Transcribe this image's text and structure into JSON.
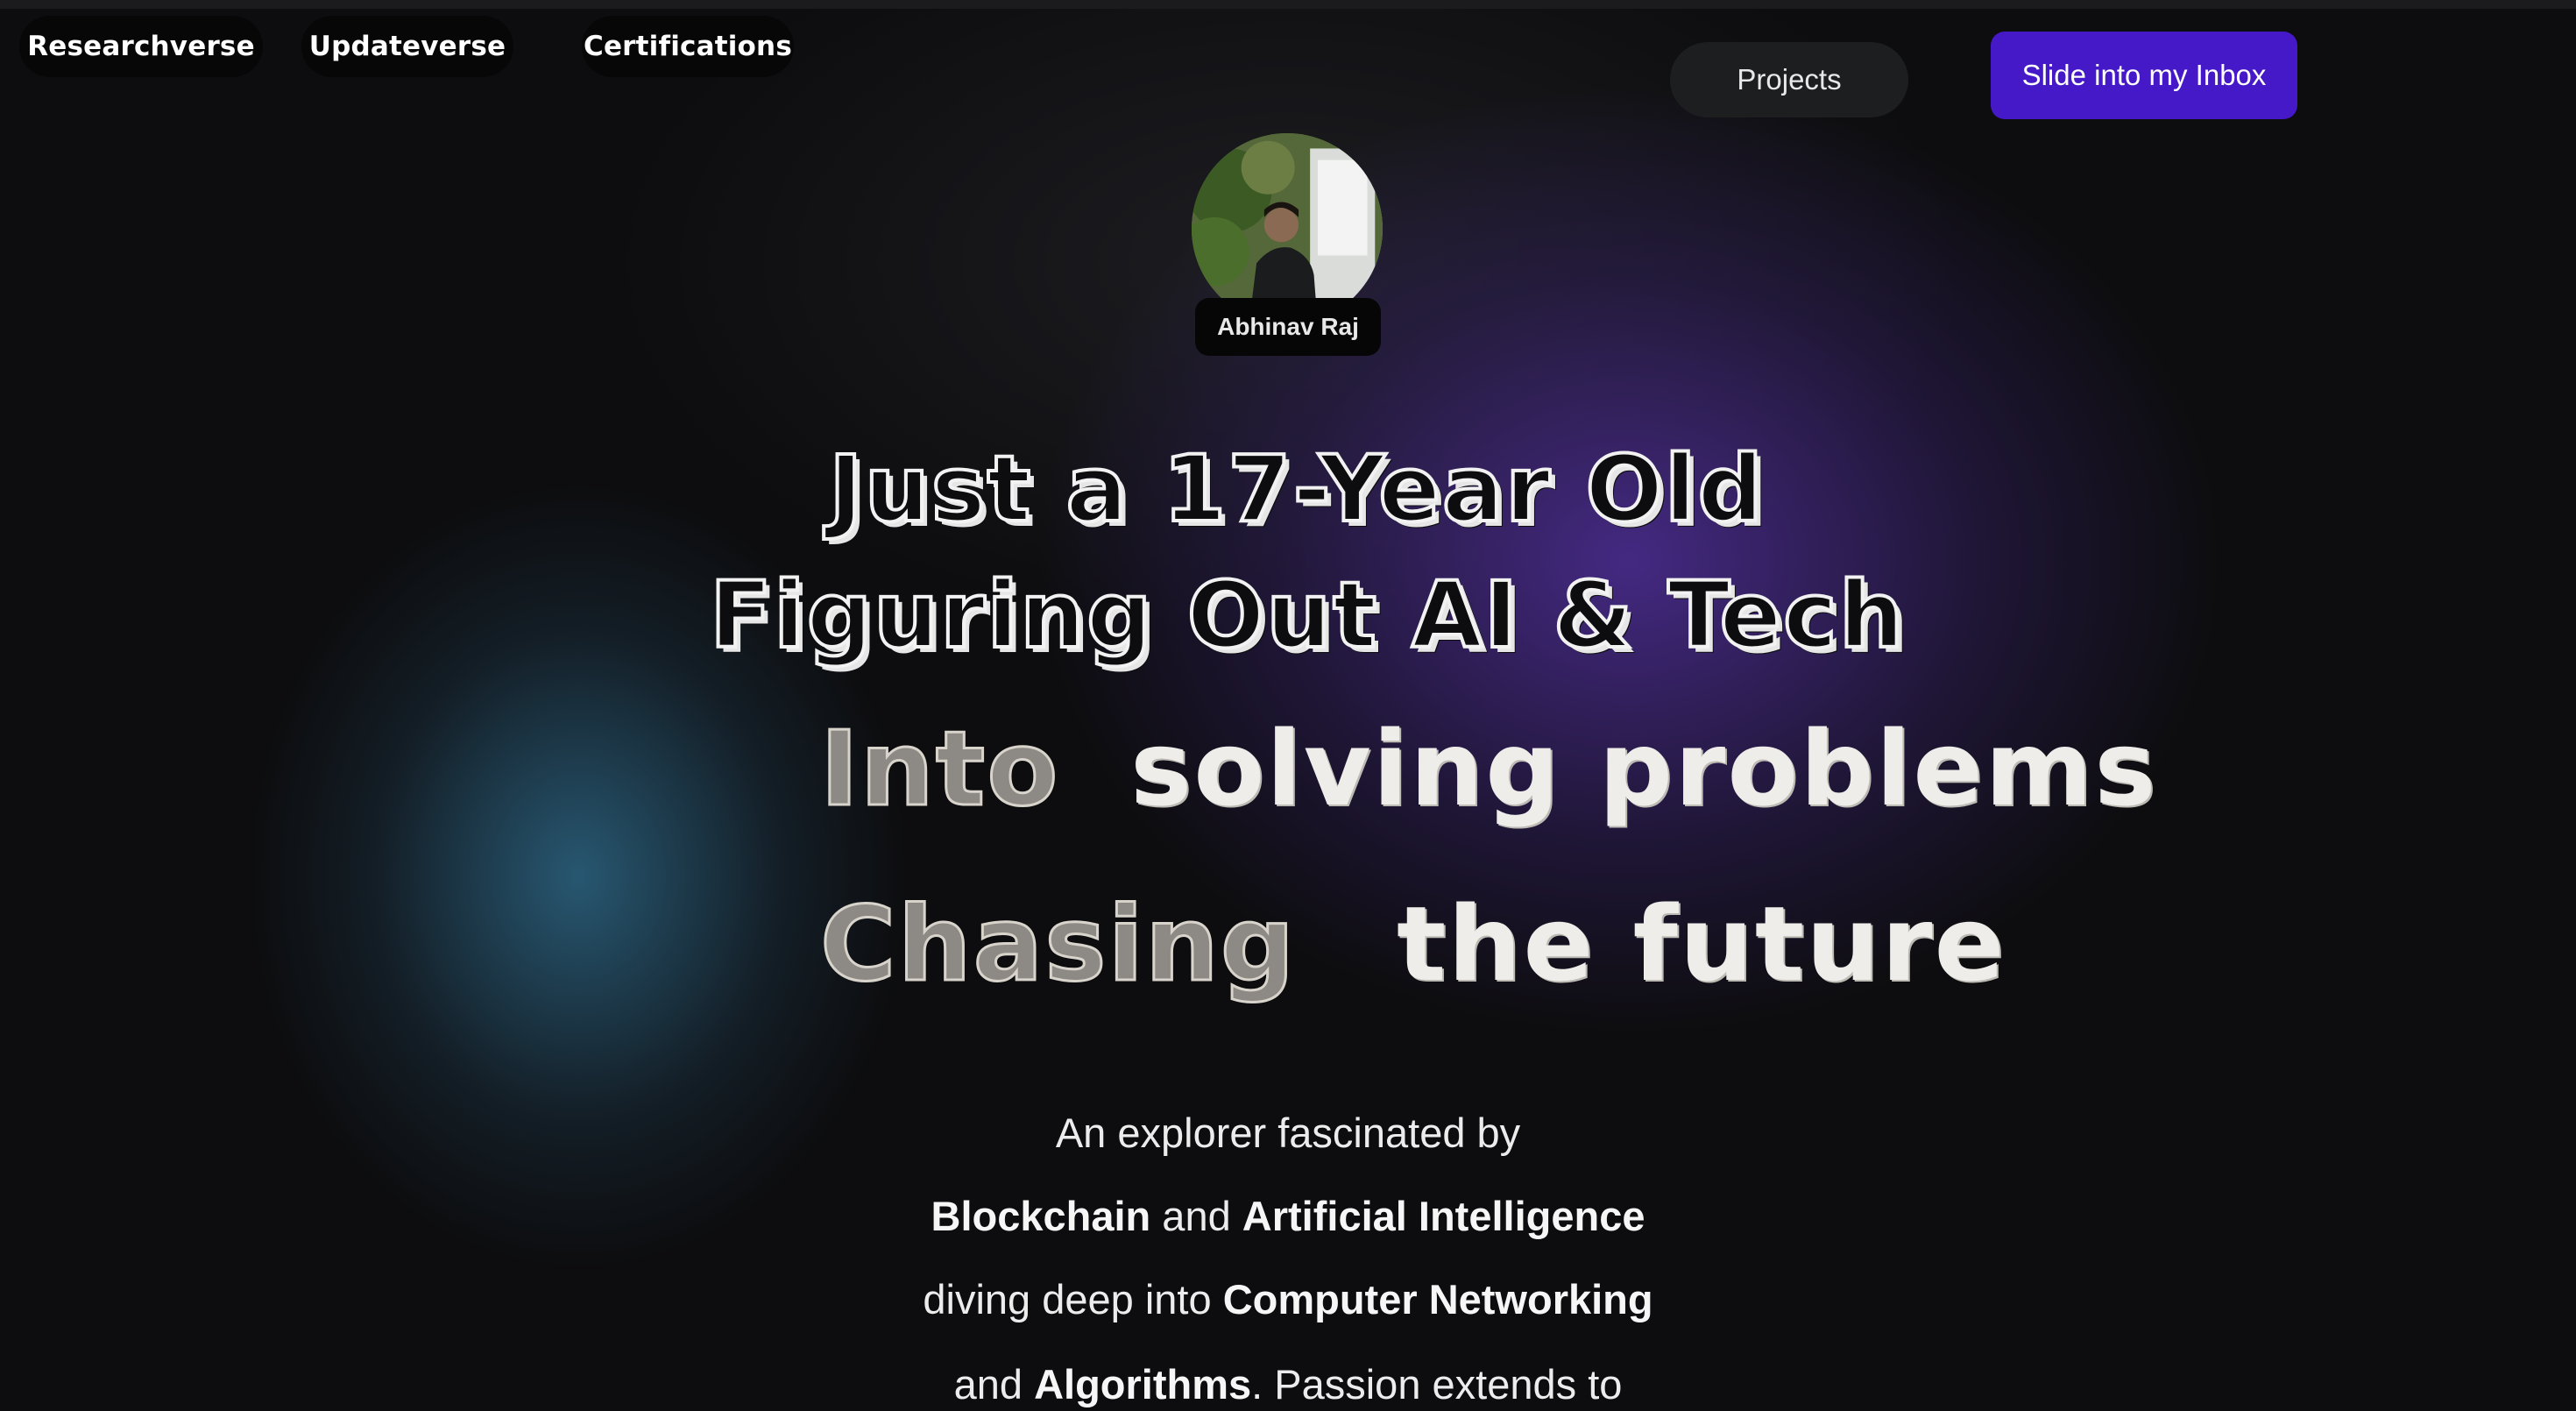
{
  "nav": {
    "researchverse": "Researchverse",
    "updateverse": "Updateverse",
    "certifications": "Certifications"
  },
  "header": {
    "projects": "Projects",
    "inbox": "Slide into my Inbox"
  },
  "profile": {
    "name": "Abhinav Raj",
    "avatar_icon": "person-photo"
  },
  "headline": {
    "line1": "Just a 17-Year Old",
    "line2": "Figuring Out AI & Tech",
    "line3_a": "Into",
    "line3_b": "solving problems",
    "line4_a": "Chasing",
    "line4_b": "the future"
  },
  "bio": {
    "p1": "An explorer fascinated by",
    "p2_b1": "Blockchain",
    "p2_t1": " and ",
    "p2_b2": "Artificial Intelligence",
    "p3_t1": "diving deep into ",
    "p3_b1": "Computer Networking",
    "p4_t1": "and ",
    "p4_b1": "Algorithms",
    "p4_t2": ". Passion extends to"
  },
  "colors": {
    "accent": "#4518c8",
    "background": "#0d0d0f",
    "glow_blue": "#2c6482",
    "glow_purple": "#4e2e96"
  }
}
